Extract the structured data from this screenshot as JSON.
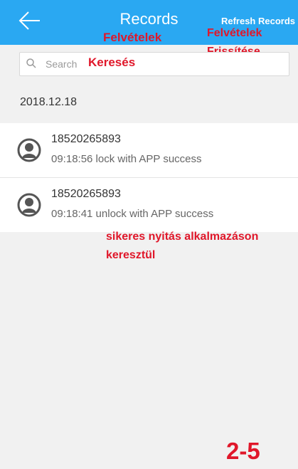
{
  "header": {
    "title": "Records",
    "refresh_label": "Refresh Records",
    "back_icon": "arrow-left-icon",
    "background": "#2aa8f2"
  },
  "search": {
    "placeholder": "Search",
    "icon": "search-icon"
  },
  "date_group": "2018.12.18",
  "records": [
    {
      "phone": "18520265893",
      "detail": "09:18:56 lock with APP success"
    },
    {
      "phone": "18520265893",
      "detail": "09:18:41 unlock with APP success"
    }
  ],
  "annotations": {
    "title": "Felvételek",
    "refresh_line1": "Felvételek",
    "refresh_line2": "Frissítése",
    "search": "Keresés",
    "detail_line1": "sikeres nyitás alkalmazáson",
    "detail_line2": "keresztül",
    "page_number": "2-5",
    "color": "#e0172a"
  }
}
